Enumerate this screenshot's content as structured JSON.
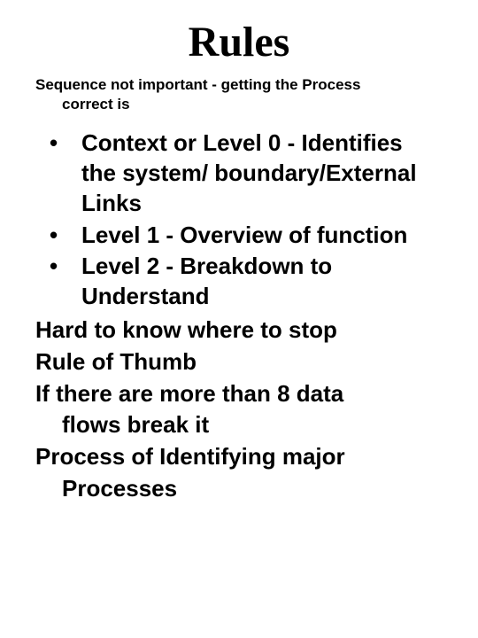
{
  "title": "Rules",
  "subtitle_line1": "Sequence not important - getting the Process",
  "subtitle_line2": "correct  is",
  "bullets": [
    "Context or Level 0 - Identifies the system/ boundary/External Links",
    "Level 1 - Overview of function",
    "Level 2 - Breakdown to Understand"
  ],
  "lines": {
    "l1": "Hard to know where to stop",
    "l2": "Rule of Thumb",
    "l3a": "If there are more than 8 data",
    "l3b": "flows break it",
    "l4a": "Process of Identifying major",
    "l4b": "Processes"
  }
}
